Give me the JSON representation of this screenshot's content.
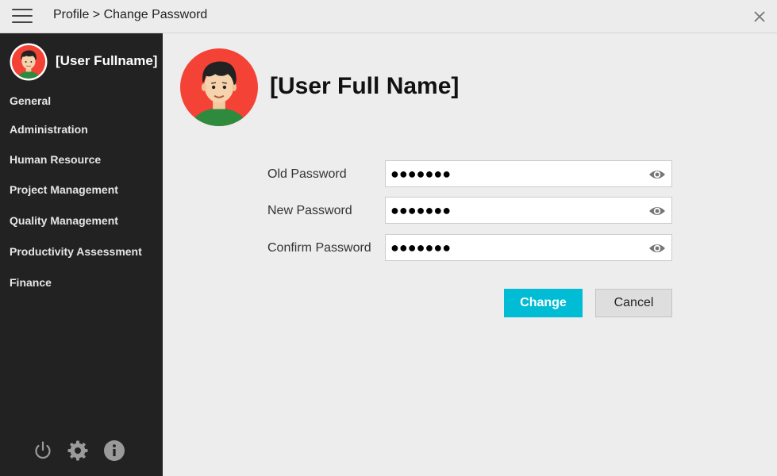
{
  "header": {
    "breadcrumb": "Profile > Change Password",
    "menu_icon": "hamburger-menu-icon",
    "close_icon": "close-icon"
  },
  "sidebar": {
    "user_name": "[User Fullname]",
    "items": [
      {
        "label": "General"
      },
      {
        "label": "Administration"
      },
      {
        "label": "Human Resource"
      },
      {
        "label": "Project Management"
      },
      {
        "label": "Quality Management"
      },
      {
        "label": "Productivity Assessment"
      },
      {
        "label": "Finance"
      }
    ],
    "bottom_icons": [
      "power-icon",
      "gear-icon",
      "info-icon"
    ]
  },
  "main": {
    "user_full_name": "[User Full Name]",
    "fields": [
      {
        "label": "Old Password",
        "value": "●●●●●●●"
      },
      {
        "label": "New Password",
        "value": "●●●●●●●"
      },
      {
        "label": "Confirm Password",
        "value": "●●●●●●●"
      }
    ],
    "change_label": "Change",
    "cancel_label": "Cancel"
  },
  "colors": {
    "accent": "#00bcd4",
    "sidebar_bg": "#222222",
    "avatar_bg": "#f44336"
  }
}
